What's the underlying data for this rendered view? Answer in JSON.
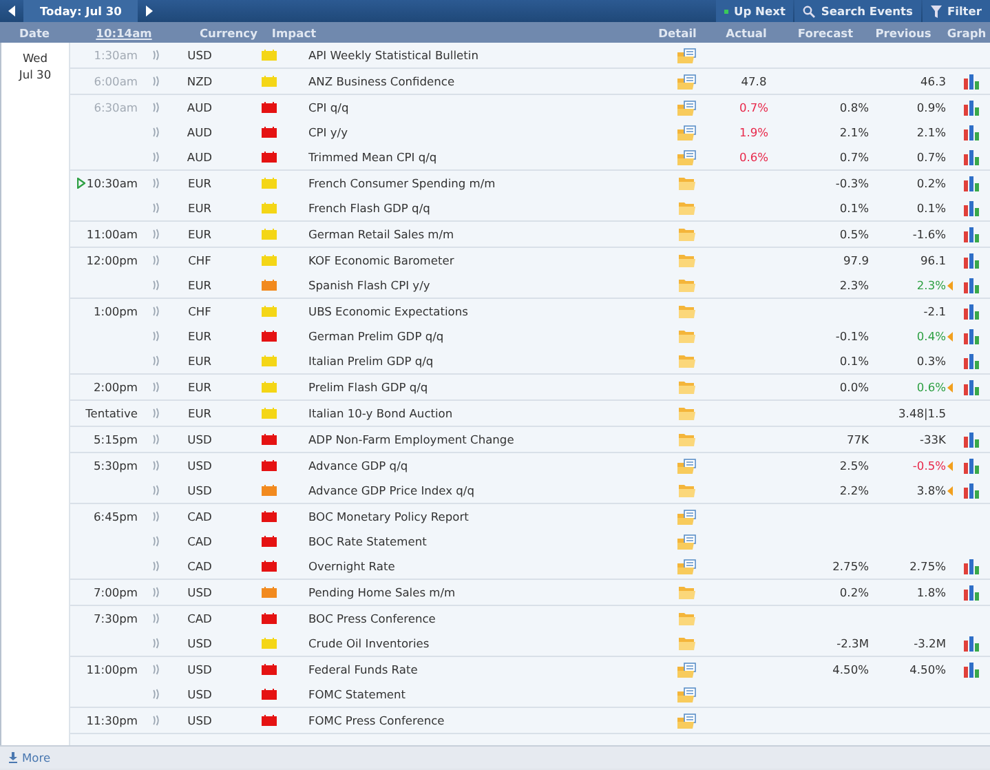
{
  "toolbar": {
    "today_tab": "Today: Jul 30",
    "up_next": "Up Next",
    "search": "Search Events",
    "filter": "Filter"
  },
  "columns": {
    "date": "Date",
    "time": "10:14am",
    "currency": "Currency",
    "impact": "Impact",
    "detail": "Detail",
    "actual": "Actual",
    "forecast": "Forecast",
    "previous": "Previous",
    "graph": "Graph"
  },
  "day": {
    "weekday": "Wed",
    "date": "Jul 30"
  },
  "groups": [
    {
      "time": "1:30am",
      "past": true,
      "next": false,
      "events": [
        {
          "currency": "USD",
          "color": "#f4d616",
          "event": "API Weekly Statistical Bulletin",
          "document": true,
          "graph": false
        }
      ]
    },
    {
      "time": "6:00am",
      "past": true,
      "next": false,
      "events": [
        {
          "currency": "NZD",
          "color": "#f4d616",
          "event": "ANZ Business Confidence",
          "document": true,
          "actual": "47.8",
          "actual_worse": false,
          "previous": "46.3",
          "previous_better": false,
          "previous_worse": false,
          "revised": false,
          "graph": true
        }
      ]
    },
    {
      "time": "6:30am",
      "past": true,
      "next": false,
      "events": [
        {
          "currency": "AUD",
          "color": "#e51212",
          "event": "CPI q/q",
          "document": true,
          "actual": "0.7%",
          "actual_worse": true,
          "forecast": "0.8%",
          "previous": "0.9%",
          "previous_better": false,
          "previous_worse": false,
          "revised": false,
          "graph": true
        },
        {
          "currency": "AUD",
          "color": "#e51212",
          "event": "CPI y/y",
          "document": true,
          "actual": "1.9%",
          "actual_worse": true,
          "forecast": "2.1%",
          "previous": "2.1%",
          "previous_better": false,
          "previous_worse": false,
          "revised": false,
          "graph": true
        },
        {
          "currency": "AUD",
          "color": "#e51212",
          "event": "Trimmed Mean CPI q/q",
          "document": true,
          "actual": "0.6%",
          "actual_worse": true,
          "forecast": "0.7%",
          "previous": "0.7%",
          "previous_better": false,
          "previous_worse": false,
          "revised": false,
          "graph": true
        }
      ]
    },
    {
      "time": "10:30am",
      "past": false,
      "next": true,
      "events": [
        {
          "currency": "EUR",
          "color": "#f4d616",
          "event": "French Consumer Spending m/m",
          "document": false,
          "forecast": "-0.3%",
          "previous": "0.2%",
          "previous_better": false,
          "previous_worse": false,
          "revised": false,
          "graph": true
        },
        {
          "currency": "EUR",
          "color": "#f4d616",
          "event": "French Flash GDP q/q",
          "document": false,
          "forecast": "0.1%",
          "previous": "0.1%",
          "previous_better": false,
          "previous_worse": false,
          "revised": false,
          "graph": true
        }
      ]
    },
    {
      "time": "11:00am",
      "past": false,
      "next": false,
      "events": [
        {
          "currency": "EUR",
          "color": "#f4d616",
          "event": "German Retail Sales m/m",
          "document": false,
          "forecast": "0.5%",
          "previous": "-1.6%",
          "previous_better": false,
          "previous_worse": false,
          "revised": false,
          "graph": true
        }
      ]
    },
    {
      "time": "12:00pm",
      "past": false,
      "next": false,
      "events": [
        {
          "currency": "CHF",
          "color": "#f4d616",
          "event": "KOF Economic Barometer",
          "document": false,
          "forecast": "97.9",
          "previous": "96.1",
          "previous_better": false,
          "previous_worse": false,
          "revised": false,
          "graph": true
        },
        {
          "currency": "EUR",
          "color": "#f28a1e",
          "event": "Spanish Flash CPI y/y",
          "document": false,
          "forecast": "2.3%",
          "previous": "2.3%",
          "previous_better": true,
          "previous_worse": false,
          "revised": true,
          "graph": true
        }
      ]
    },
    {
      "time": "1:00pm",
      "past": false,
      "next": false,
      "events": [
        {
          "currency": "CHF",
          "color": "#f4d616",
          "event": "UBS Economic Expectations",
          "document": false,
          "previous": "-2.1",
          "previous_better": false,
          "previous_worse": false,
          "revised": false,
          "graph": true
        },
        {
          "currency": "EUR",
          "color": "#e51212",
          "event": "German Prelim GDP q/q",
          "document": false,
          "forecast": "-0.1%",
          "previous": "0.4%",
          "previous_better": true,
          "previous_worse": false,
          "revised": true,
          "graph": true
        },
        {
          "currency": "EUR",
          "color": "#f4d616",
          "event": "Italian Prelim GDP q/q",
          "document": false,
          "forecast": "0.1%",
          "previous": "0.3%",
          "previous_better": false,
          "previous_worse": false,
          "revised": false,
          "graph": true
        }
      ]
    },
    {
      "time": "2:00pm",
      "past": false,
      "next": false,
      "events": [
        {
          "currency": "EUR",
          "color": "#f4d616",
          "event": "Prelim Flash GDP q/q",
          "document": false,
          "forecast": "0.0%",
          "previous": "0.6%",
          "previous_better": true,
          "previous_worse": false,
          "revised": true,
          "graph": true
        }
      ]
    },
    {
      "time": "Tentative",
      "past": false,
      "next": false,
      "events": [
        {
          "currency": "EUR",
          "color": "#f4d616",
          "event": "Italian 10-y Bond Auction",
          "document": false,
          "previous": "3.48|1.5",
          "previous_better": false,
          "previous_worse": false,
          "revised": false,
          "graph": false
        }
      ]
    },
    {
      "time": "5:15pm",
      "past": false,
      "next": false,
      "events": [
        {
          "currency": "USD",
          "color": "#e51212",
          "event": "ADP Non-Farm Employment Change",
          "document": false,
          "forecast": "77K",
          "previous": "-33K",
          "previous_better": false,
          "previous_worse": false,
          "revised": false,
          "graph": true
        }
      ]
    },
    {
      "time": "5:30pm",
      "past": false,
      "next": false,
      "events": [
        {
          "currency": "USD",
          "color": "#e51212",
          "event": "Advance GDP q/q",
          "document": true,
          "forecast": "2.5%",
          "previous": "-0.5%",
          "previous_better": false,
          "previous_worse": true,
          "revised": true,
          "graph": true
        },
        {
          "currency": "USD",
          "color": "#f28a1e",
          "event": "Advance GDP Price Index q/q",
          "document": false,
          "forecast": "2.2%",
          "previous": "3.8%",
          "previous_better": false,
          "previous_worse": false,
          "revised": true,
          "graph": true
        }
      ]
    },
    {
      "time": "6:45pm",
      "past": false,
      "next": false,
      "events": [
        {
          "currency": "CAD",
          "color": "#e51212",
          "event": "BOC Monetary Policy Report",
          "document": true,
          "graph": false
        },
        {
          "currency": "CAD",
          "color": "#e51212",
          "event": "BOC Rate Statement",
          "document": true,
          "graph": false
        },
        {
          "currency": "CAD",
          "color": "#e51212",
          "event": "Overnight Rate",
          "document": true,
          "forecast": "2.75%",
          "previous": "2.75%",
          "previous_better": false,
          "previous_worse": false,
          "revised": false,
          "graph": true
        }
      ]
    },
    {
      "time": "7:00pm",
      "past": false,
      "next": false,
      "events": [
        {
          "currency": "USD",
          "color": "#f28a1e",
          "event": "Pending Home Sales m/m",
          "document": false,
          "forecast": "0.2%",
          "previous": "1.8%",
          "previous_better": false,
          "previous_worse": false,
          "revised": false,
          "graph": true
        }
      ]
    },
    {
      "time": "7:30pm",
      "past": false,
      "next": false,
      "events": [
        {
          "currency": "CAD",
          "color": "#e51212",
          "event": "BOC Press Conference",
          "document": false,
          "graph": false
        },
        {
          "currency": "USD",
          "color": "#f4d616",
          "event": "Crude Oil Inventories",
          "document": false,
          "forecast": "-2.3M",
          "previous": "-3.2M",
          "previous_better": false,
          "previous_worse": false,
          "revised": false,
          "graph": true
        }
      ]
    },
    {
      "time": "11:00pm",
      "past": false,
      "next": false,
      "events": [
        {
          "currency": "USD",
          "color": "#e51212",
          "event": "Federal Funds Rate",
          "document": true,
          "forecast": "4.50%",
          "previous": "4.50%",
          "previous_better": false,
          "previous_worse": false,
          "revised": false,
          "graph": true
        },
        {
          "currency": "USD",
          "color": "#e51212",
          "event": "FOMC Statement",
          "document": true,
          "graph": false
        }
      ]
    },
    {
      "time": "11:30pm",
      "past": false,
      "next": false,
      "events": [
        {
          "currency": "USD",
          "color": "#e51212",
          "event": "FOMC Press Conference",
          "document": true,
          "graph": false
        }
      ]
    }
  ],
  "footer": {
    "more": "More"
  }
}
